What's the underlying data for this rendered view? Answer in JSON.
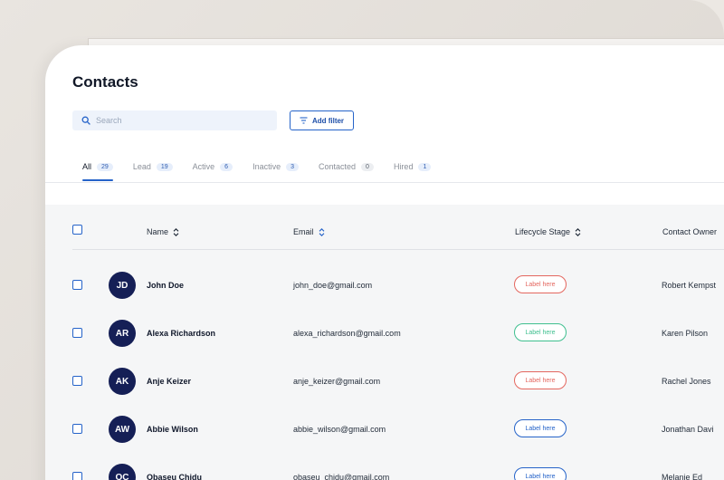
{
  "page": {
    "title": "Contacts"
  },
  "search": {
    "placeholder": "Search"
  },
  "filter": {
    "label": "Add filter"
  },
  "tabs": [
    {
      "label": "All",
      "count": "29"
    },
    {
      "label": "Lead",
      "count": "19"
    },
    {
      "label": "Active",
      "count": "6"
    },
    {
      "label": "Inactive",
      "count": "3"
    },
    {
      "label": "Contacted",
      "count": "0"
    },
    {
      "label": "Hired",
      "count": "1"
    }
  ],
  "columns": {
    "name": "Name",
    "email": "Email",
    "stage": "Lifecycle Stage",
    "owner": "Contact Owner"
  },
  "rows": [
    {
      "initials": "JD",
      "name": "John Doe",
      "email": "john_doe@gmail.com",
      "label": "Label here",
      "owner": "Robert Kempst"
    },
    {
      "initials": "AR",
      "name": "Alexa Richardson",
      "email": "alexa_richardson@gmail.com",
      "label": "Label here",
      "owner": "Karen Pilson"
    },
    {
      "initials": "AK",
      "name": "Anje Keizer",
      "email": "anje_keizer@gmail.com",
      "label": "Label here",
      "owner": "Rachel Jones"
    },
    {
      "initials": "AW",
      "name": "Abbie Wilson",
      "email": "abbie_wilson@gmail.com",
      "label": "Label here",
      "owner": "Jonathan Davi"
    },
    {
      "initials": "OC",
      "name": "Obaseu Chidu",
      "email": "obaseu_chidu@gmail.com",
      "label": "Label here",
      "owner": "Melanie Ed"
    }
  ],
  "colors": {
    "accent": "#2563c9",
    "avatar": "#151f56",
    "label_red": "#e4675f",
    "label_green": "#3fbf8f",
    "label_blue": "#2563c9"
  }
}
